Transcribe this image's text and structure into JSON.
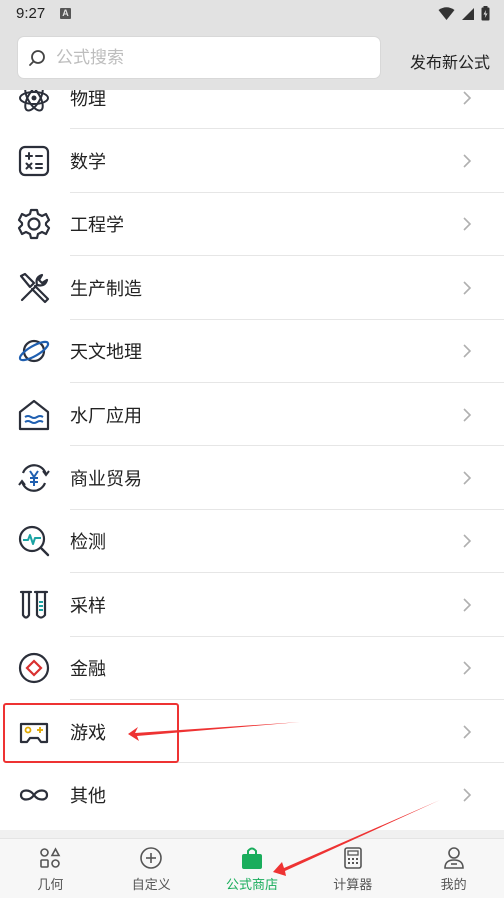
{
  "status_bar": {
    "time": "9:27",
    "notification_letter": "A"
  },
  "header": {
    "search_placeholder": "公式搜索",
    "publish_label": "发布新公式"
  },
  "categories": [
    {
      "label": "物理",
      "icon": "atom-icon"
    },
    {
      "label": "数学",
      "icon": "math-calculator-icon"
    },
    {
      "label": "工程学",
      "icon": "gear-icon"
    },
    {
      "label": "生产制造",
      "icon": "tools-icon"
    },
    {
      "label": "天文地理",
      "icon": "planet-icon"
    },
    {
      "label": "水厂应用",
      "icon": "water-house-icon"
    },
    {
      "label": "商业贸易",
      "icon": "yen-exchange-icon"
    },
    {
      "label": "检测",
      "icon": "monitor-search-icon"
    },
    {
      "label": "采样",
      "icon": "test-tube-icon"
    },
    {
      "label": "金融",
      "icon": "diamond-circle-icon"
    },
    {
      "label": "游戏",
      "icon": "gamepad-icon"
    },
    {
      "label": "其他",
      "icon": "infinity-icon"
    }
  ],
  "tabs": [
    {
      "label": "几何",
      "icon": "grid-shapes-icon",
      "active": false
    },
    {
      "label": "自定义",
      "icon": "plus-circle-icon",
      "active": false
    },
    {
      "label": "公式商店",
      "icon": "shopping-bag-icon",
      "active": true
    },
    {
      "label": "计算器",
      "icon": "calculator-icon",
      "active": false
    },
    {
      "label": "我的",
      "icon": "user-icon",
      "active": false
    }
  ],
  "colors": {
    "accent": "#1aad5c",
    "annotation": "#ee3333",
    "header_bg": "#e2e2e2"
  }
}
